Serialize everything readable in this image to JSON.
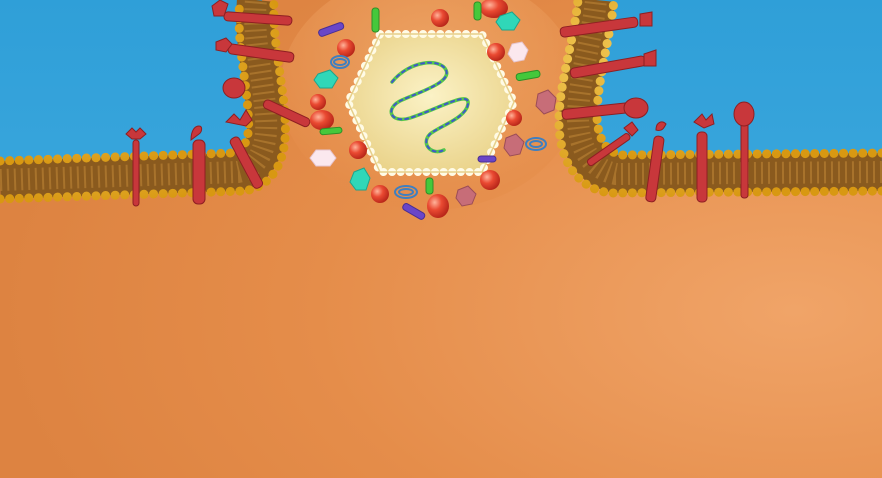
{
  "scene": {
    "subject": "virus-budding-through-cell-membrane",
    "colors": {
      "extracellular": "#3aa6dd",
      "cytoplasm": "#e58d4a",
      "cytoplasm_light": "#f0a468",
      "lipid_head": "#f2b21c",
      "lipid_head_dark": "#b98213",
      "membrane_core": "#8a5a1e",
      "receptor": "#c8373b",
      "capsid_fill": "#f3e2a2",
      "capsid_bead": "#f8f1cf",
      "rna_green": "#57c84a",
      "rna_blue": "#3f57c9",
      "protein_red": "#e53c2a",
      "enzyme_cyan": "#30d7b8",
      "hex_pink": "#c76d78",
      "rod_purple": "#6a46c8",
      "rod_green": "#45c83b",
      "coil_blue": "#3f7fc0"
    }
  }
}
